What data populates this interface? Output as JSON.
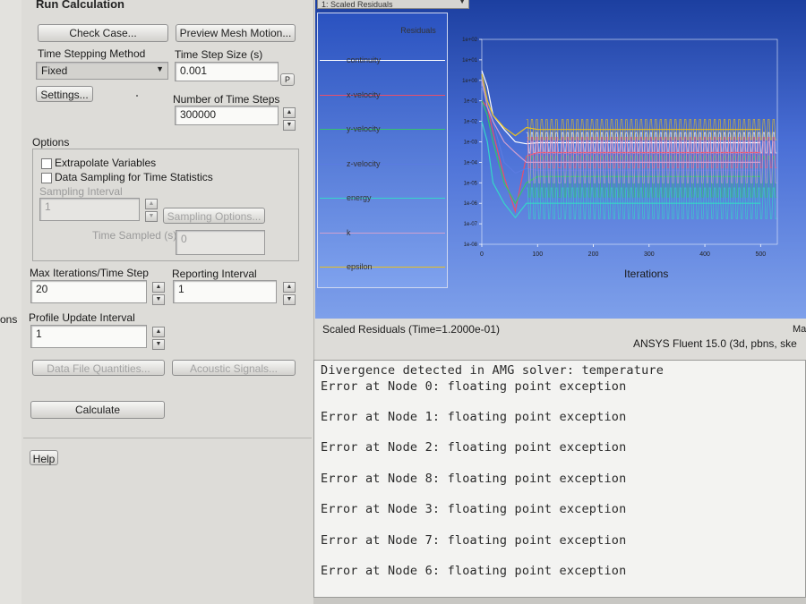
{
  "panel": {
    "title": "Run Calculation",
    "check_case": "Check Case...",
    "preview_mesh": "Preview Mesh Motion...",
    "time_stepping_label": "Time Stepping Method",
    "time_stepping_value": "Fixed",
    "time_step_size_label": "Time Step Size (s)",
    "time_step_size_value": "0.001",
    "p_button": "P",
    "settings": "Settings...",
    "num_steps_label": "Number of Time Steps",
    "num_steps_value": "300000",
    "options_label": "Options",
    "extrapolate": "Extrapolate Variables",
    "data_sampling": "Data Sampling for Time Statistics",
    "sampling_interval_label": "Sampling Interval",
    "sampling_interval_value": "1",
    "sampling_options": "Sampling Options...",
    "time_sampled_label": "Time Sampled (s)",
    "time_sampled_value": "0",
    "max_iter_label": "Max Iterations/Time Step",
    "max_iter_value": "20",
    "reporting_label": "Reporting Interval",
    "reporting_value": "1",
    "profile_label": "Profile Update Interval",
    "profile_value": "1",
    "data_file_q": "Data File Quantities...",
    "acoustic": "Acoustic Signals...",
    "calculate": "Calculate",
    "help": "Help",
    "left_edge_text": "ons"
  },
  "plot": {
    "dropdown": "1: Scaled Residuals",
    "legend_title": "Residuals",
    "legend": [
      {
        "name": "continuity",
        "color": "#ffffff"
      },
      {
        "name": "x-velocity",
        "color": "#e8506a"
      },
      {
        "name": "y-velocity",
        "color": "#35c46a"
      },
      {
        "name": "z-velocity",
        "color": "#5a7be0"
      },
      {
        "name": "energy",
        "color": "#36d6c8"
      },
      {
        "name": "k",
        "color": "#d0a0d0"
      },
      {
        "name": "epsilon",
        "color": "#e8c020"
      }
    ],
    "y_ticks": [
      "1e+02",
      "1e+01",
      "1e+00",
      "1e-01",
      "1e-02",
      "1e-03",
      "1e-04",
      "1e-05",
      "1e-06",
      "1e-07",
      "1e-08"
    ],
    "x_ticks": [
      "0",
      "100",
      "200",
      "300",
      "400",
      "500"
    ],
    "xlabel": "Iterations",
    "caption": "Scaled Residuals  (Time=1.2000e-01)",
    "version": "ANSYS Fluent 15.0 (3d, pbns, ske",
    "right_edge": "Ma"
  },
  "chart_data": {
    "type": "line",
    "title": "",
    "xlabel": "Iterations",
    "ylabel": "",
    "xlim": [
      0,
      530
    ],
    "ylog": true,
    "ylim": [
      1e-08,
      100
    ],
    "series": [
      {
        "name": "continuity",
        "x": [
          0,
          10,
          20,
          40,
          60,
          80,
          100,
          200,
          300,
          400,
          500
        ],
        "y": [
          3.0,
          0.5,
          0.02,
          0.004,
          0.001,
          0.0008,
          0.0009,
          0.0009,
          0.0009,
          0.0009,
          0.0009
        ]
      },
      {
        "name": "x-velocity",
        "x": [
          0,
          10,
          20,
          40,
          60,
          80,
          100,
          200,
          300,
          400,
          500
        ],
        "y": [
          0.1,
          0.05,
          0.003,
          2e-05,
          4e-07,
          0.0002,
          0.0003,
          0.0003,
          0.0003,
          0.0003,
          0.0003
        ]
      },
      {
        "name": "y-velocity",
        "x": [
          0,
          10,
          20,
          40,
          60,
          80,
          100,
          200,
          300,
          400,
          500
        ],
        "y": [
          0.1,
          0.02,
          0.001,
          1e-05,
          1e-06,
          1e-05,
          2e-05,
          2e-05,
          2e-05,
          2e-05,
          2e-05
        ]
      },
      {
        "name": "z-velocity",
        "x": [
          0,
          10,
          20,
          40,
          60,
          80,
          100,
          200,
          300,
          400,
          500
        ],
        "y": [
          0.5,
          0.1,
          0.01,
          0.0001,
          3e-05,
          5e-05,
          4e-05,
          4e-05,
          4e-05,
          4e-05,
          4e-05
        ]
      },
      {
        "name": "energy",
        "x": [
          0,
          10,
          20,
          40,
          60,
          80,
          100,
          200,
          300,
          400,
          500
        ],
        "y": [
          0.01,
          0.001,
          1e-05,
          1e-06,
          2e-07,
          1e-06,
          1e-06,
          1e-06,
          1e-06,
          1e-06,
          1e-06
        ]
      },
      {
        "name": "k",
        "x": [
          0,
          10,
          20,
          40,
          60,
          80,
          100,
          200,
          300,
          400,
          500
        ],
        "y": [
          1.0,
          0.05,
          0.01,
          0.001,
          0.0003,
          0.0001,
          0.0001,
          0.0001,
          0.0001,
          0.0001,
          0.0001
        ]
      },
      {
        "name": "epsilon",
        "x": [
          0,
          10,
          20,
          40,
          60,
          80,
          100,
          200,
          300,
          400,
          500
        ],
        "y": [
          2.0,
          0.1,
          0.02,
          0.005,
          0.002,
          0.005,
          0.004,
          0.004,
          0.004,
          0.004,
          0.004
        ]
      }
    ]
  },
  "console": [
    "Divergence detected in AMG solver: temperature",
    "Error at Node 0: floating point exception",
    "Error at Node 1: floating point exception",
    "Error at Node 2: floating point exception",
    "Error at Node 8: floating point exception",
    "Error at Node 3: floating point exception",
    "Error at Node 7: floating point exception",
    "Error at Node 6: floating point exception"
  ]
}
